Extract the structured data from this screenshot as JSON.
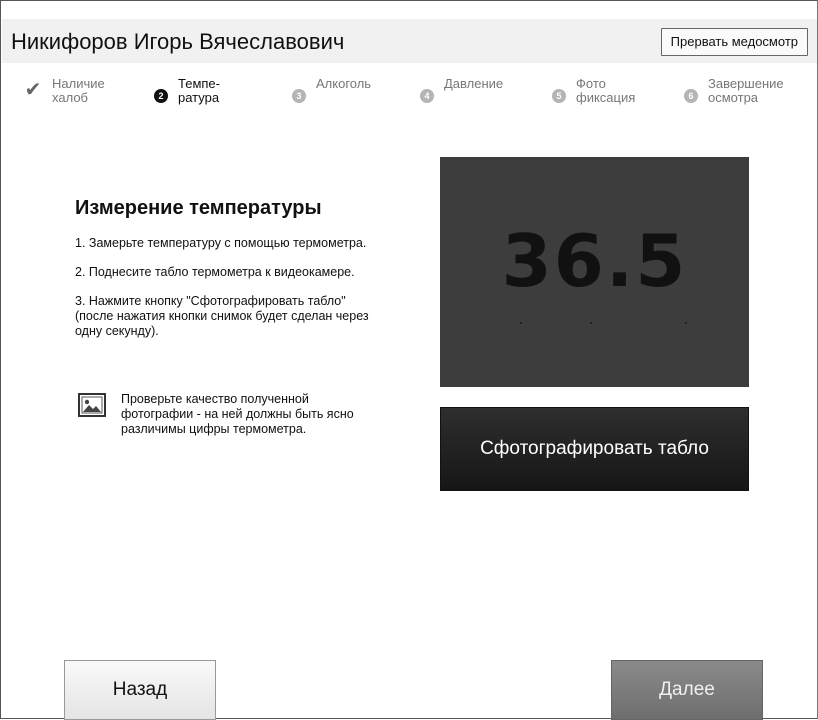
{
  "header": {
    "patient_name": "Никифоров Игорь Вячеславович",
    "abort_label": "Прервать медосмотр"
  },
  "steps": [
    {
      "number": "",
      "label": "Наличие\nхалоб",
      "state": "done"
    },
    {
      "number": "2",
      "label": "Темпе-\nратура",
      "state": "current"
    },
    {
      "number": "3",
      "label": "Алкоголь",
      "state": "pending"
    },
    {
      "number": "4",
      "label": "Давление",
      "state": "pending"
    },
    {
      "number": "5",
      "label": "Фото\nфиксация",
      "state": "pending"
    },
    {
      "number": "6",
      "label": "Завершение\nосмотра",
      "state": "pending"
    }
  ],
  "instructions": {
    "title": "Измерение температуры",
    "step1": "1. Замерьте температуру с помощью термометра.",
    "step2": "2. Поднесите табло термометра к видеокамере.",
    "step3": "3. Нажмите кнопку \"Сфотографировать табло\" (после нажатия кнопки снимок будет сделан через одну секунду).",
    "tip": "Проверьте качество полученной фотографии - на ней должны быть ясно различимы цифры термометра.",
    "tip_icon": "image-icon"
  },
  "preview": {
    "reading": "36.5"
  },
  "buttons": {
    "photo": "Сфотографировать табло",
    "back": "Назад",
    "next": "Далее"
  },
  "colors": {
    "header_bg": "#f1f1f1",
    "preview_bg": "#3d3d3d",
    "photo_button_bg": "#1f1f1f",
    "next_button_bg": "#7a7a7a"
  }
}
